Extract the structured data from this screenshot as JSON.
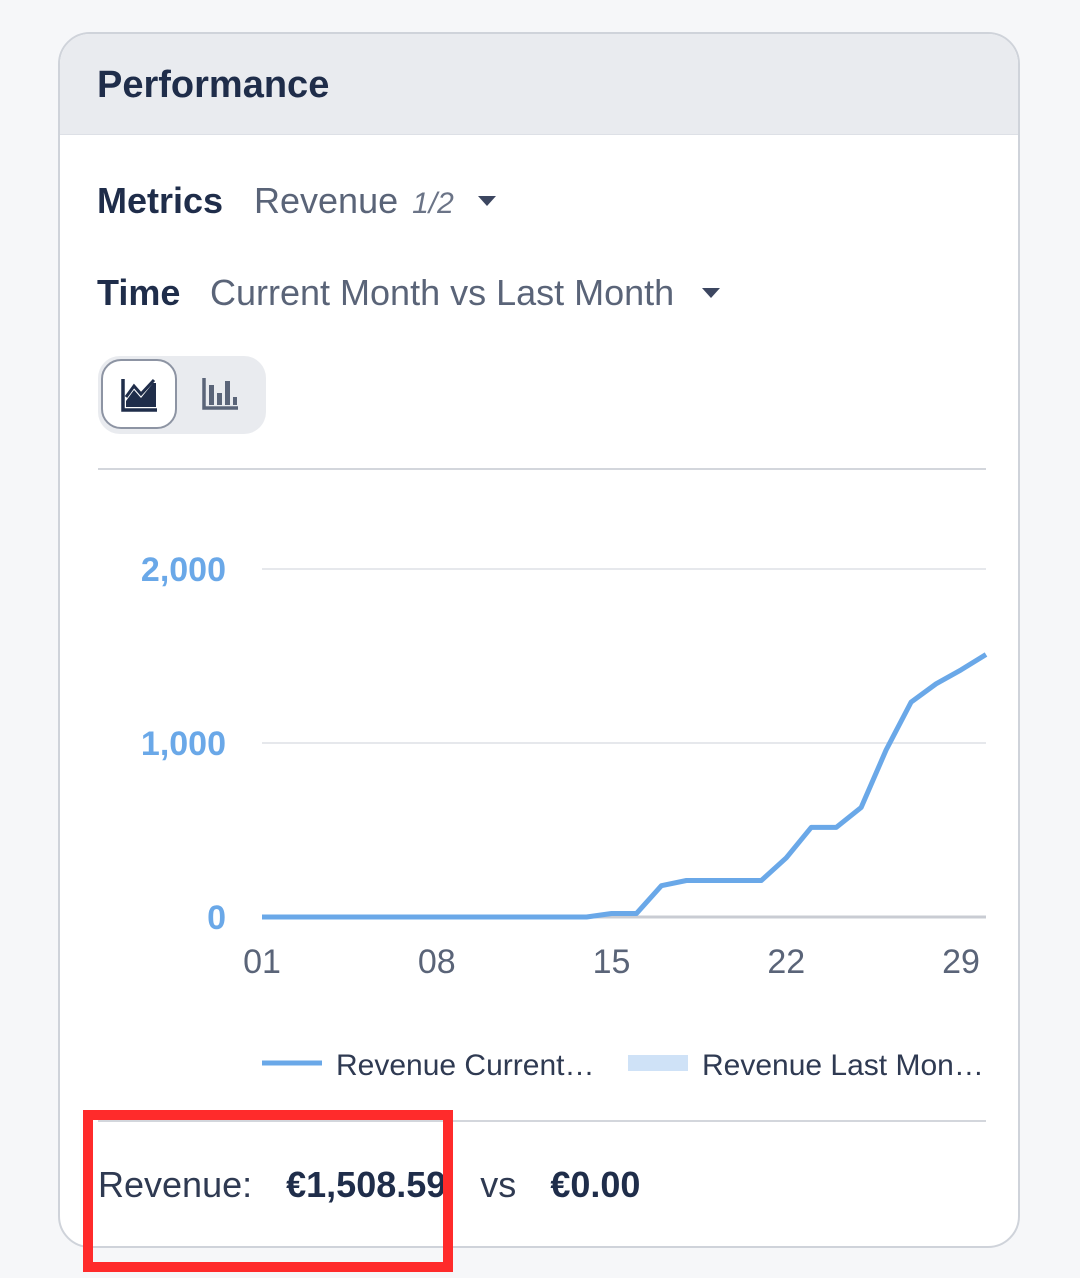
{
  "card": {
    "title": "Performance"
  },
  "metrics": {
    "label": "Metrics",
    "value": "Revenue",
    "count": "1/2"
  },
  "time": {
    "label": "Time",
    "value": "Current Month vs Last Month"
  },
  "view_toggle": {
    "active": "line",
    "line_icon": "line-chart-icon",
    "bar_icon": "bar-chart-icon"
  },
  "colors": {
    "current_series": "#6aa8e8",
    "last_series": "#cfe2f7",
    "axis_labels": "#6aa8e8",
    "highlight": "#ff2b2b"
  },
  "chart_data": {
    "type": "line",
    "x_tick_labels": [
      "01",
      "08",
      "15",
      "22",
      "29"
    ],
    "y_tick_labels": [
      "0",
      "1,000",
      "2,000"
    ],
    "ylim": [
      0,
      2000
    ],
    "xlim": [
      1,
      30
    ],
    "grid": true,
    "legend_position": "bottom",
    "series": [
      {
        "name": "Revenue Current…",
        "x": [
          1,
          14,
          15,
          16,
          17,
          18,
          19,
          20,
          21,
          22,
          23,
          24,
          25,
          26,
          27,
          28,
          29,
          30
        ],
        "values": [
          0,
          0,
          20,
          20,
          180,
          210,
          210,
          210,
          210,
          340,
          515,
          515,
          630,
          960,
          1235,
          1340,
          1420,
          1508.59
        ]
      },
      {
        "name": "Revenue Last Mon…",
        "x": [
          1,
          30
        ],
        "values": [
          0,
          0
        ]
      }
    ]
  },
  "summary": {
    "label": "Revenue:",
    "current": "€1,508.59",
    "vs": "vs",
    "previous": "€0.00"
  }
}
